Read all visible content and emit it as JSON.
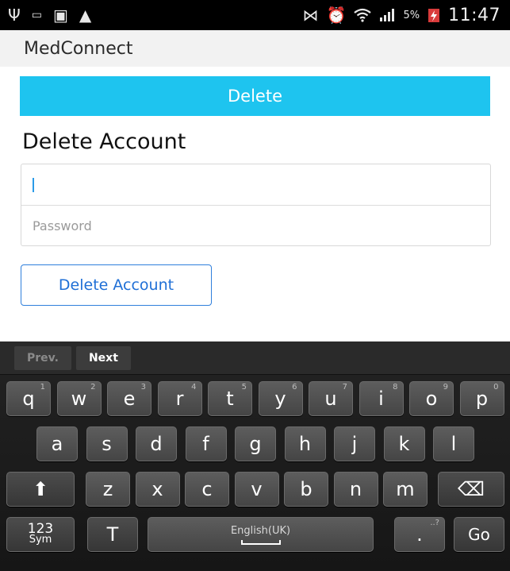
{
  "status_bar": {
    "left_icons": [
      "usb-icon",
      "voicemail-icon",
      "sd-card-icon",
      "warning-icon"
    ],
    "right_icons": [
      "nfc-icon",
      "alarm-icon",
      "wifi-icon",
      "signal-icon"
    ],
    "battery_percent": "5%",
    "time": "11:47"
  },
  "app": {
    "title": "MedConnect"
  },
  "banner": {
    "label": "Delete"
  },
  "section": {
    "title": "Delete Account"
  },
  "form": {
    "username": {
      "value": "",
      "placeholder": ""
    },
    "password": {
      "value": "",
      "placeholder": "Password"
    }
  },
  "actions": {
    "delete_account_label": "Delete Account"
  },
  "keyboard": {
    "prev_label": "Prev.",
    "next_label": "Next",
    "row1": [
      {
        "key": "q",
        "hint": "1"
      },
      {
        "key": "w",
        "hint": "2"
      },
      {
        "key": "e",
        "hint": "3"
      },
      {
        "key": "r",
        "hint": "4"
      },
      {
        "key": "t",
        "hint": "5"
      },
      {
        "key": "y",
        "hint": "6"
      },
      {
        "key": "u",
        "hint": "7"
      },
      {
        "key": "i",
        "hint": "8"
      },
      {
        "key": "o",
        "hint": "9"
      },
      {
        "key": "p",
        "hint": "0"
      }
    ],
    "row2": [
      "a",
      "s",
      "d",
      "f",
      "g",
      "h",
      "j",
      "k",
      "l"
    ],
    "row3": [
      "z",
      "x",
      "c",
      "v",
      "b",
      "n",
      "m"
    ],
    "sym_label_top": "123",
    "sym_label_bottom": "Sym",
    "space_label": "English(UK)",
    "period_label": ".",
    "period_hint": "..?",
    "go_label": "Go",
    "shift_glyph": "⬆",
    "backspace_glyph": "⌫",
    "handwriting_glyph": "T"
  }
}
